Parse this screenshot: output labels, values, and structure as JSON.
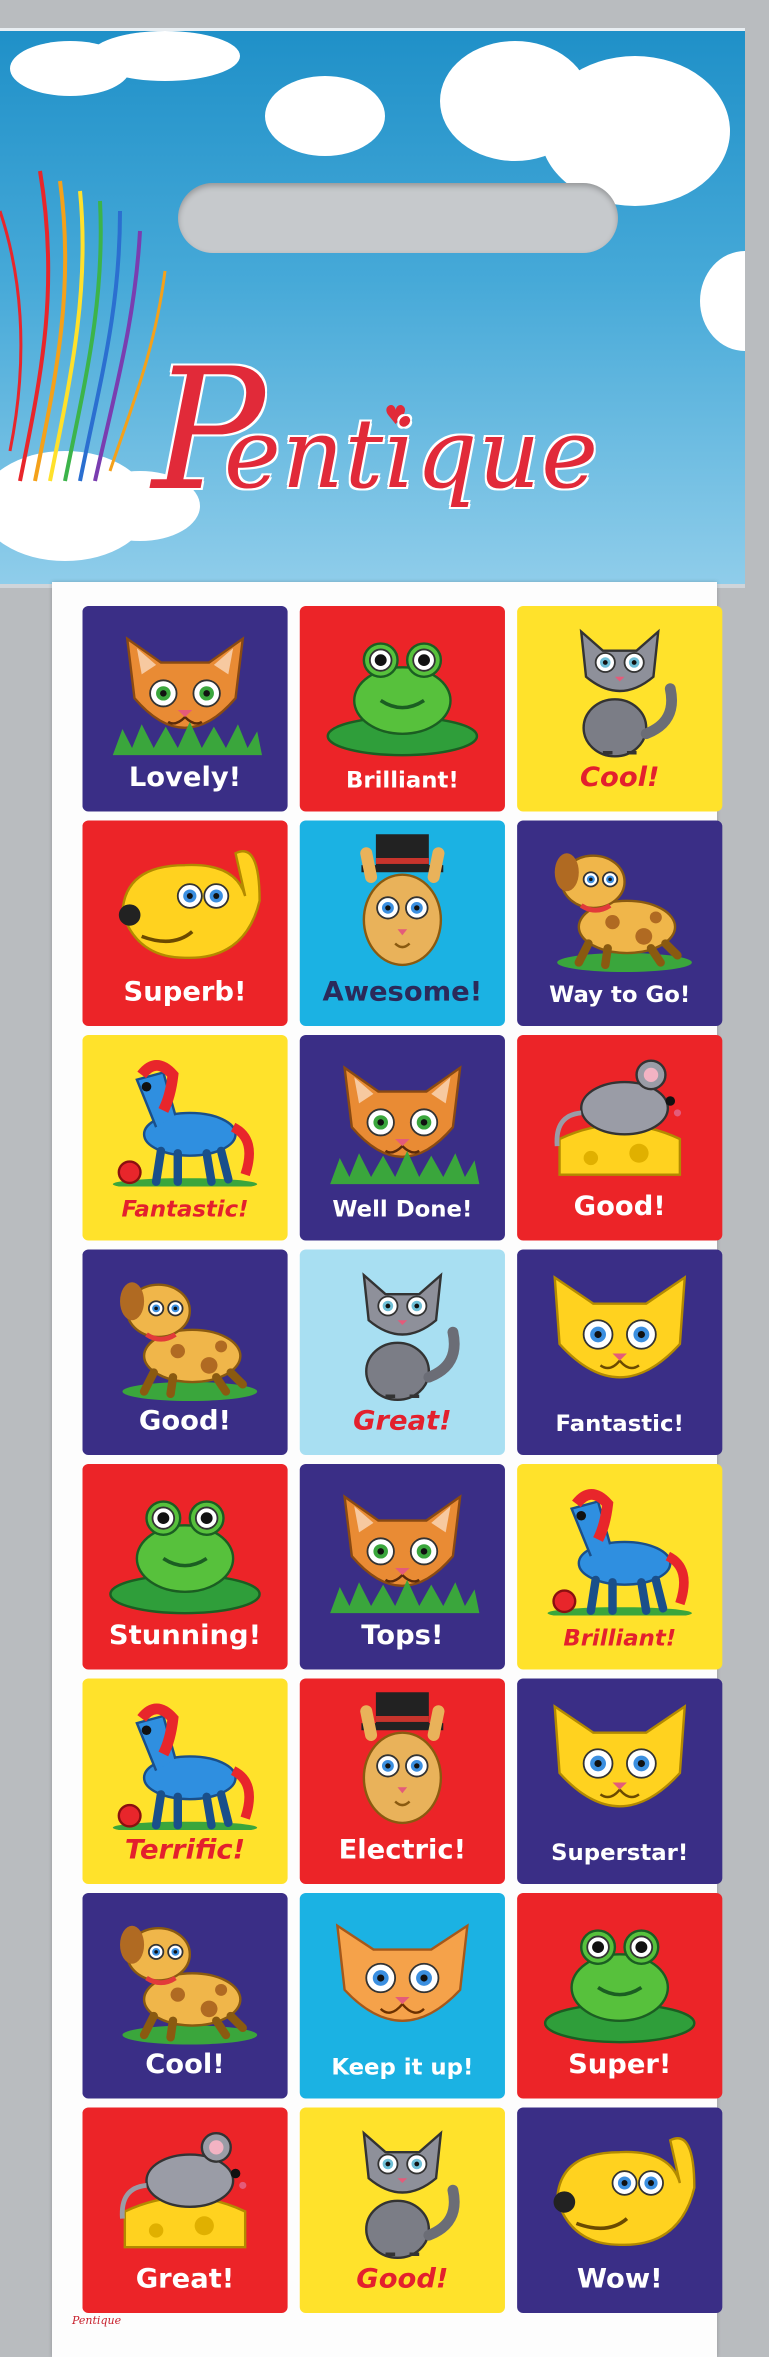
{
  "brand": {
    "logo_initial": "P",
    "logo_rest": "entique",
    "footer_logo": "Pentique"
  },
  "colors": {
    "purple": "#3a2e86",
    "red": "#ec2428",
    "yellow": "#ffe22b",
    "cyan": "#1bb2e3",
    "light_blue": "#a8dff2"
  },
  "stickers": [
    {
      "label": "Lovely!",
      "bg": "#3a2e86",
      "icon": "cat-face-icon",
      "text_style": "white"
    },
    {
      "label": "Brilliant!",
      "bg": "#ec2428",
      "icon": "frog-icon",
      "text_style": "white"
    },
    {
      "label": "Cool!",
      "bg": "#ffe22b",
      "icon": "grey-kitten-icon",
      "text_style": "red"
    },
    {
      "label": "Superb!",
      "bg": "#ec2428",
      "icon": "dog-head-icon",
      "text_style": "white"
    },
    {
      "label": "Awesome!",
      "bg": "#1bb2e3",
      "icon": "rabbit-top-hat-icon",
      "text_style": "dark"
    },
    {
      "label": "Way to Go!",
      "bg": "#3a2e86",
      "icon": "puppy-icon",
      "text_style": "white"
    },
    {
      "label": "Fantastic!",
      "bg": "#ffe22b",
      "icon": "pony-icon",
      "text_style": "red"
    },
    {
      "label": "Well Done!",
      "bg": "#3a2e86",
      "icon": "cat-face-icon",
      "text_style": "white"
    },
    {
      "label": "Good!",
      "bg": "#ec2428",
      "icon": "mouse-cheese-icon",
      "text_style": "white"
    },
    {
      "label": "Good!",
      "bg": "#3a2e86",
      "icon": "puppy-icon",
      "text_style": "white"
    },
    {
      "label": "Great!",
      "bg": "#a8dff2",
      "icon": "grey-kitten-icon",
      "text_style": "red"
    },
    {
      "label": "Fantastic!",
      "bg": "#3a2e86",
      "icon": "yellow-cat-face-icon",
      "text_style": "white"
    },
    {
      "label": "Stunning!",
      "bg": "#ec2428",
      "icon": "frog-icon",
      "text_style": "white"
    },
    {
      "label": "Tops!",
      "bg": "#3a2e86",
      "icon": "cat-face-icon",
      "text_style": "white"
    },
    {
      "label": "Brilliant!",
      "bg": "#ffe22b",
      "icon": "pony-icon",
      "text_style": "red"
    },
    {
      "label": "Terrific!",
      "bg": "#ffe22b",
      "icon": "pony-icon",
      "text_style": "red"
    },
    {
      "label": "Electric!",
      "bg": "#ec2428",
      "icon": "rabbit-top-hat-icon",
      "text_style": "white"
    },
    {
      "label": "Superstar!",
      "bg": "#3a2e86",
      "icon": "yellow-cat-face-icon",
      "text_style": "white"
    },
    {
      "label": "Cool!",
      "bg": "#3a2e86",
      "icon": "puppy-icon",
      "text_style": "white"
    },
    {
      "label": "Keep it up!",
      "bg": "#1bb2e3",
      "icon": "orange-cat-face-icon",
      "text_style": "white"
    },
    {
      "label": "Super!",
      "bg": "#ec2428",
      "icon": "frog-icon",
      "text_style": "white"
    },
    {
      "label": "Great!",
      "bg": "#ec2428",
      "icon": "mouse-cheese-icon",
      "text_style": "white"
    },
    {
      "label": "Good!",
      "bg": "#ffe22b",
      "icon": "grey-kitten-icon",
      "text_style": "red"
    },
    {
      "label": "Wow!",
      "bg": "#3a2e86",
      "icon": "dog-head-icon",
      "text_style": "white"
    }
  ]
}
